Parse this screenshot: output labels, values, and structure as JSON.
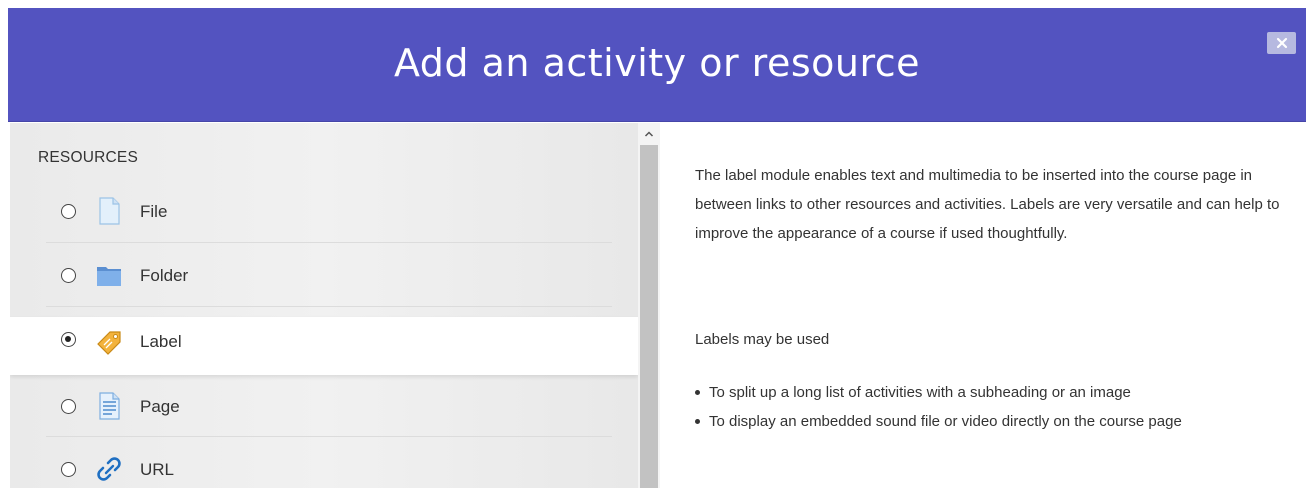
{
  "dialog": {
    "title": "Add an activity or resource",
    "close_icon": "close-icon",
    "header_color": "#5353c0"
  },
  "options": {
    "section_title": "RESOURCES",
    "items": [
      {
        "label": "File",
        "icon": "file-icon",
        "selected": false
      },
      {
        "label": "Folder",
        "icon": "folder-icon",
        "selected": false
      },
      {
        "label": "Label",
        "icon": "label-tag-icon",
        "selected": true
      },
      {
        "label": "Page",
        "icon": "page-icon",
        "selected": false
      },
      {
        "label": "URL",
        "icon": "url-link-icon",
        "selected": false
      }
    ]
  },
  "help": {
    "intro": "The label module enables text and multimedia to be inserted into the course page in between links to other resources and activities. Labels are very versatile and can help to improve the appearance of a course if used thoughtfully.",
    "uses_heading": "Labels may be used",
    "bullets": [
      "To split up a long list of activities with a subheading or an image",
      "To display an embedded sound file or video directly on the course page"
    ]
  }
}
